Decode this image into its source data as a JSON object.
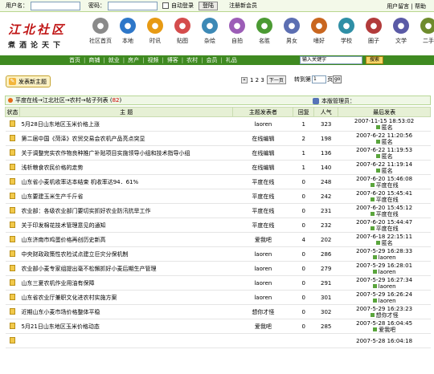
{
  "login": {
    "username_label": "用户名：",
    "password_label": "密码：",
    "autologin_label": "自动登录",
    "login_button": "登陆",
    "register_link": "注册新会员",
    "top_right": "用户留言 | 帮助"
  },
  "logo": {
    "line1": "江北社区",
    "line2": "煮酒论天下"
  },
  "nav": [
    {
      "label": "社区首页",
      "icon": "home-icon",
      "color": "#8a8a8a"
    },
    {
      "label": "本地",
      "icon": "location-icon",
      "color": "#2e77c9"
    },
    {
      "label": "时讯",
      "icon": "news-icon",
      "color": "#e79a14"
    },
    {
      "label": "贴图",
      "icon": "picture-icon",
      "color": "#d44c4c"
    },
    {
      "label": "杂烩",
      "icon": "mix-icon",
      "color": "#3d89b6"
    },
    {
      "label": "自拍",
      "icon": "camera-icon",
      "color": "#9c5db7"
    },
    {
      "label": "名胜",
      "icon": "landmark-icon",
      "color": "#4b9a33"
    },
    {
      "label": "男女",
      "icon": "couple-icon",
      "color": "#5c6fb2"
    },
    {
      "label": "嗜好",
      "icon": "hobby-icon",
      "color": "#c9661f"
    },
    {
      "label": "学校",
      "icon": "school-icon",
      "color": "#2f8fa6"
    },
    {
      "label": "圈子",
      "icon": "circle-icon",
      "color": "#b23b3b"
    },
    {
      "label": "文学",
      "icon": "book-icon",
      "color": "#5a5aa6"
    },
    {
      "label": "二手",
      "icon": "secondhand-icon",
      "color": "#6e8b2c"
    }
  ],
  "menu": [
    "首页",
    "商铺",
    "就业",
    "房产",
    "视频",
    "博客",
    "农村",
    "会员",
    "礼品"
  ],
  "search": {
    "placeholder": "输入关键字",
    "button": "搜索"
  },
  "new_topic": "发表新主题",
  "pager": {
    "pages": "1 2 3",
    "next": "下一页",
    "jump_label": "转到第",
    "jump_unit": "页",
    "go": "go",
    "jump_value": "1"
  },
  "breadcrumb": {
    "path": "平度在线→江北社区→农村→帖子列表 (",
    "count": "82",
    "close": ")",
    "managers": "本版管理员："
  },
  "table": {
    "headers": [
      "状态",
      "主 题",
      "主题发表者",
      "回复",
      "人气",
      "最后发表"
    ],
    "rows": [
      {
        "title": "5月28日山东地区玉米价格上涨",
        "author": "laoren",
        "replies": "1",
        "views": "323",
        "last_time": "2007-11-15 18:53:02",
        "last_user": "匿名"
      },
      {
        "title": "第二届中国《菏泽》农贸交易会农机产品亮点突显",
        "author": "在线编辑",
        "replies": "2",
        "views": "198",
        "last_time": "2007-6-22 11:20:56",
        "last_user": "匿名"
      },
      {
        "title": "关于调整完实农作物良种推广补贴项目实施领导小组和技术指导小组",
        "author": "在线编辑",
        "replies": "1",
        "views": "136",
        "last_time": "2007-6-22 11:19:53",
        "last_user": "匿名"
      },
      {
        "title": "浅析粮食农民价格的走势",
        "author": "在线编辑",
        "replies": "1",
        "views": "140",
        "last_time": "2007-6-22 11:19:14",
        "last_user": "匿名"
      },
      {
        "title": "山东省小麦机收率达本结束 机收率达94．61%",
        "author": "平度在线",
        "replies": "0",
        "views": "248",
        "last_time": "2007-6-20 15:46:08",
        "last_user": "平度在线"
      },
      {
        "title": "山东要建玉米生产千斤省",
        "author": "平度在线",
        "replies": "0",
        "views": "242",
        "last_time": "2007-6-20 15:45:41",
        "last_user": "平度在线"
      },
      {
        "title": "农业部：各级农业部门要切实抓好农业防汛抗旱工作",
        "author": "平度在线",
        "replies": "0",
        "views": "231",
        "last_time": "2007-6-20 15:45:12",
        "last_user": "平度在线"
      },
      {
        "title": "关于印发棉花技术管理意见的通知",
        "author": "平度在线",
        "replies": "0",
        "views": "232",
        "last_time": "2007-6-20 15:44:47",
        "last_user": "平度在线"
      },
      {
        "title": "山东济南市鸡蛋价格再创历史新高",
        "author": "爱我吧",
        "replies": "4",
        "views": "202",
        "last_time": "2007-6-18 22:15:11",
        "last_user": "匿名"
      },
      {
        "title": "中央财政政策性农险试点建立巨灾分保机制",
        "author": "laoren",
        "replies": "0",
        "views": "286",
        "last_time": "2007-5-29 16:28:33",
        "last_user": "laoren"
      },
      {
        "title": "农业部小麦专家组提出毫不松懈抓好小麦后期生产管理",
        "author": "laoren",
        "replies": "0",
        "views": "279",
        "last_time": "2007-5-29 16:28:01",
        "last_user": "laoren"
      },
      {
        "title": "山东三夏农机作业用油有保障",
        "author": "laoren",
        "replies": "0",
        "views": "291",
        "last_time": "2007-5-29 16:27:34",
        "last_user": "laoren"
      },
      {
        "title": "山东省农业厅兼职文化进农村实施方案",
        "author": "laoren",
        "replies": "0",
        "views": "301",
        "last_time": "2007-5-29 16:26:24",
        "last_user": "laoren"
      },
      {
        "title": "近期山东小麦市场价格整体平稳",
        "author": "想你才怪",
        "replies": "0",
        "views": "302",
        "last_time": "2007-5-29 16:23:23",
        "last_user": "想你才怪"
      },
      {
        "title": "5月21日山东地区玉米价格动态",
        "author": "爱我吧",
        "replies": "0",
        "views": "285",
        "last_time": "2007-5-28 16:04:45",
        "last_user": "爱我吧"
      },
      {
        "title": "",
        "author": "",
        "replies": "",
        "views": "",
        "last_time": "2007-5-28 16:04:18",
        "last_user": ""
      }
    ]
  }
}
